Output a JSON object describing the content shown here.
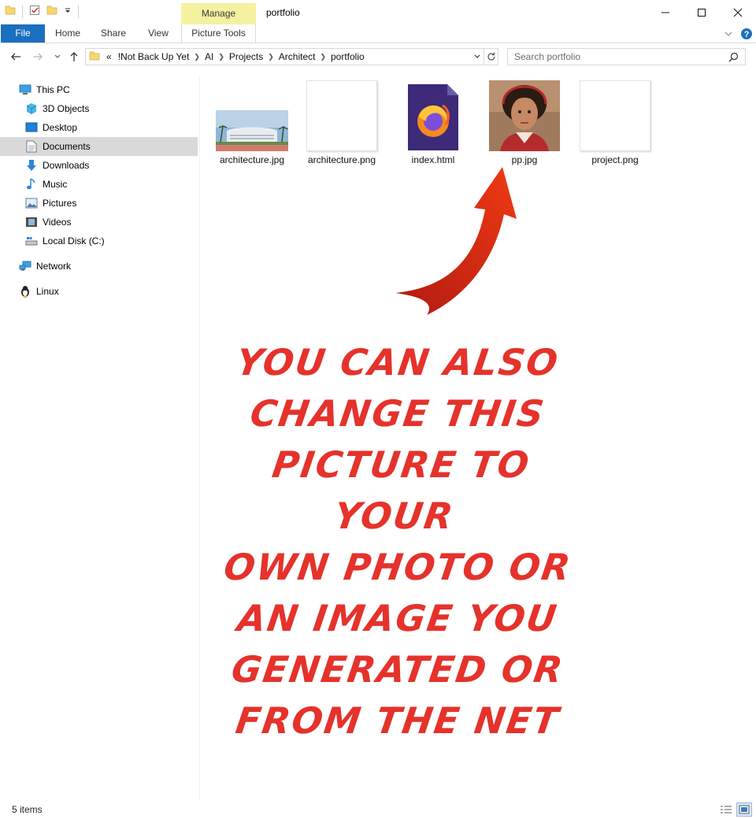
{
  "window": {
    "title": "portfolio",
    "contextual_tab": "Manage"
  },
  "ribbon": {
    "tabs": [
      "File",
      "Home",
      "Share",
      "View",
      "Picture Tools"
    ],
    "file_color": "#1a6fbf",
    "contextual_color": "#f5f1a0"
  },
  "address": {
    "overflow": "«",
    "crumbs": [
      "!Not Back Up Yet",
      "AI",
      "Projects",
      "Architect",
      "portfolio"
    ],
    "search_placeholder": "Search portfolio"
  },
  "nav": {
    "this_pc": "This PC",
    "items": [
      "3D Objects",
      "Desktop",
      "Documents",
      "Downloads",
      "Music",
      "Pictures",
      "Videos",
      "Local Disk (C:)"
    ],
    "selected": "Documents",
    "network": "Network",
    "linux": "Linux"
  },
  "files": [
    {
      "name": "architecture.jpg",
      "icon": "building-photo-thumbnail"
    },
    {
      "name": "architecture.png",
      "icon": "blank-image-thumbnail"
    },
    {
      "name": "index.html",
      "icon": "firefox-document-icon"
    },
    {
      "name": "pp.jpg",
      "icon": "portrait-photo-thumbnail"
    },
    {
      "name": "project.png",
      "icon": "blank-image-thumbnail"
    }
  ],
  "annotation": {
    "lines": [
      "YOU CAN ALSO",
      "CHANGE THIS",
      "PICTURE TO YOUR",
      "OWN PHOTO OR",
      "AN IMAGE YOU",
      "GENERATED OR",
      "FROM THE NET"
    ],
    "color": "#e5322b"
  },
  "status": {
    "count": "5 items"
  }
}
